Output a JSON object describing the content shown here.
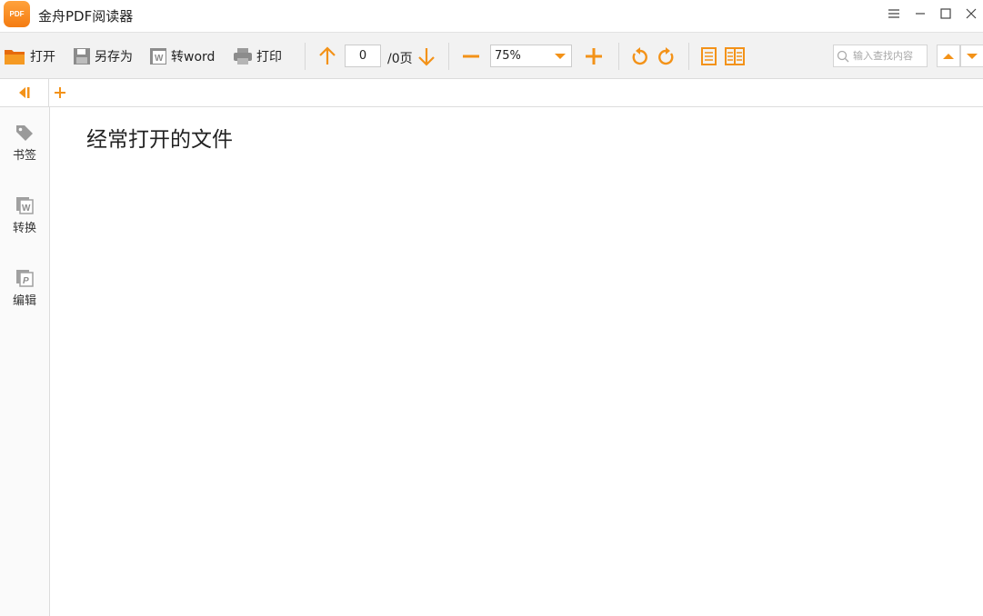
{
  "window": {
    "app_title": "金舟PDF阅读器",
    "logo_text": "PDF",
    "controls": {
      "menu": "menu-icon",
      "minimize": "minimize-icon",
      "maximize": "maximize-icon",
      "close": "close-icon"
    }
  },
  "toolbar": {
    "open_label": "打开",
    "save_as_label": "另存为",
    "to_word_label": "转word",
    "print_label": "打印",
    "page_current": "0",
    "page_total": "/0页",
    "zoom_value": "75%",
    "search_placeholder": "输入查找内容"
  },
  "sidebar": {
    "items": [
      {
        "label": "书签",
        "icon": "tag-icon"
      },
      {
        "label": "转换",
        "icon": "word-convert-icon"
      },
      {
        "label": "编辑",
        "icon": "pdf-edit-icon"
      }
    ]
  },
  "main": {
    "heading": "经常打开的文件"
  },
  "colors": {
    "accent": "#f39218",
    "toolbar_bg": "#f2f2f2",
    "icon_gray": "#8c8c8c"
  }
}
